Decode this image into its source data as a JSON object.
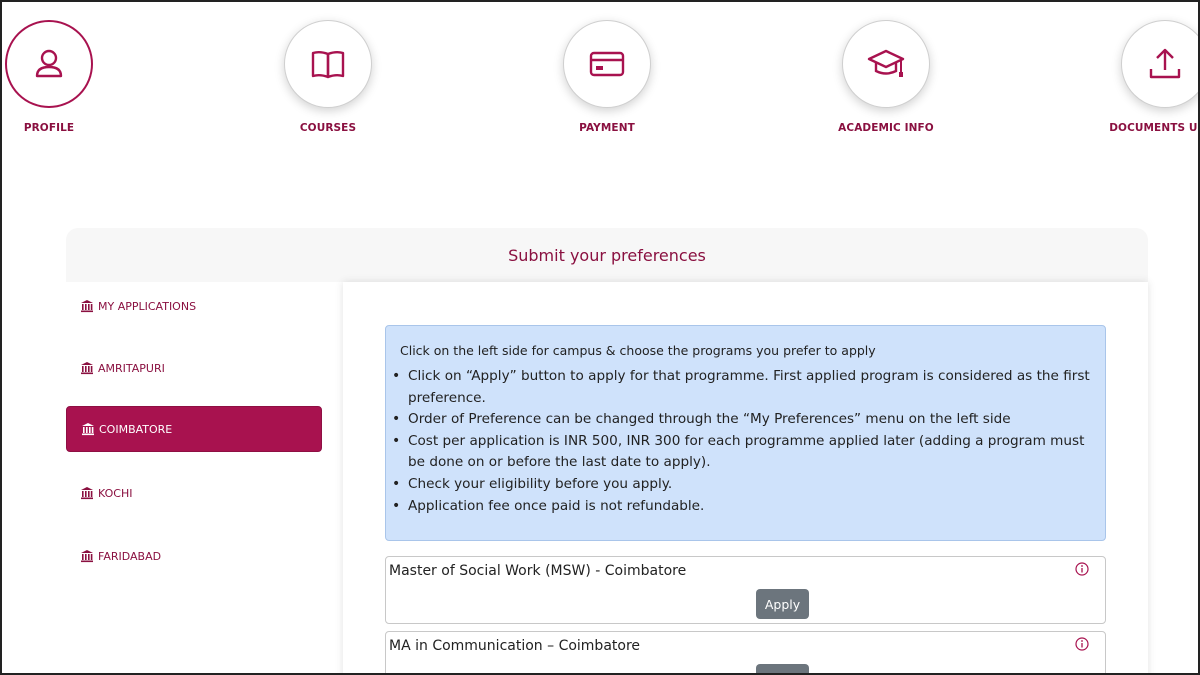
{
  "steps": [
    {
      "label": "PROFILE",
      "icon": "user-icon",
      "active": true
    },
    {
      "label": "COURSES",
      "icon": "book-icon"
    },
    {
      "label": "PAYMENT",
      "icon": "credit-card-icon"
    },
    {
      "label": "ACADEMIC INFO",
      "icon": "graduation-cap-icon"
    },
    {
      "label": "DOCUMENTS UPLO",
      "icon": "upload-icon"
    }
  ],
  "card": {
    "title": "Submit your preferences"
  },
  "sidebar": {
    "items": [
      {
        "label": "MY APPLICATIONS",
        "icon": "bank-icon"
      },
      {
        "label": "AMRITAPURI",
        "icon": "bank-icon"
      },
      {
        "label": "COIMBATORE",
        "icon": "bank-icon",
        "active": true
      },
      {
        "label": "KOCHI",
        "icon": "bank-icon"
      },
      {
        "label": "FARIDABAD",
        "icon": "bank-icon"
      }
    ]
  },
  "info": {
    "intro": "Click on the left side for campus & choose the programs you prefer to apply",
    "bullets": [
      "Click on “Apply” button to apply for that programme. First applied program is considered as the first preference.",
      "Order of Preference can be changed through the “My Preferences” menu on the left side",
      "Cost per application is INR 500, INR 300 for each programme applied later (adding a program must be done on or before the last date to apply).",
      "Check your eligibility before you apply.",
      "Application fee once paid is not refundable."
    ]
  },
  "programs": [
    {
      "name": "Master of Social Work (MSW) - Coimbatore",
      "button": "Apply",
      "icon": "info-circle-icon"
    },
    {
      "name": "MA in Communication – Coimbatore",
      "button": "Apply",
      "icon": "info-circle-icon"
    }
  ],
  "colors": {
    "brand": "#a8124f",
    "brand_text": "#8a1040",
    "info_bg": "#cfe2fb",
    "button_gray": "#6c757d"
  }
}
